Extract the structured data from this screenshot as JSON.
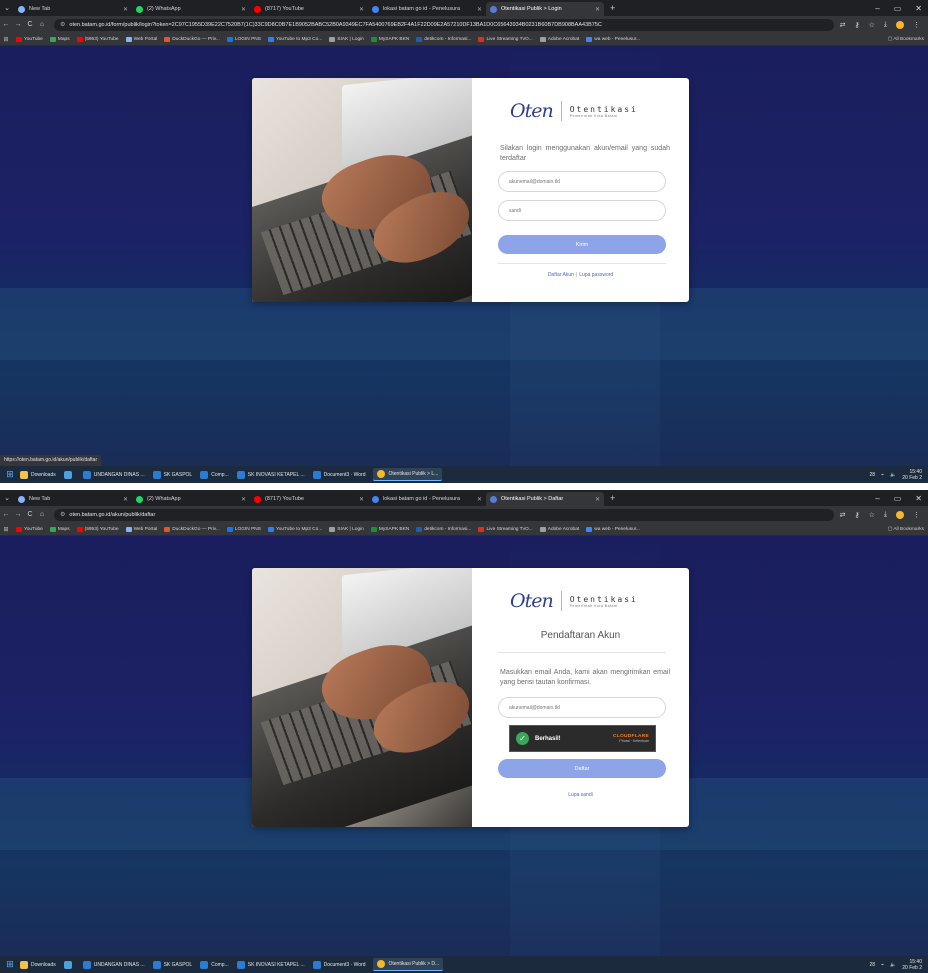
{
  "shots": [
    {
      "tabs": [
        {
          "label": "New Tab",
          "color": "#8ab4f8",
          "active": false
        },
        {
          "label": "(2) WhatsApp",
          "color": "#25d366",
          "active": false
        },
        {
          "label": "(8717) YouTube",
          "color": "#ff0000",
          "active": false
        },
        {
          "label": "lokasi batam go id - Penelusura",
          "color": "#4285f4",
          "active": false
        },
        {
          "label": "Otentikasi Publik > Login",
          "color": "#5b7bd8",
          "active": true
        }
      ],
      "url": "oten.batam.go.id/form/publik/login?token=2C97C1955D39E22C7520B7(1C)33C9D8C0B7E1B9052BABC52B0A9349EC7FA5400769EB2F4A1F22D09E2A57210DF13BA1D0C65643934B0231B60B7DB908BAA43B75C",
      "form": {
        "description": "Silakan login menggunakan akun/email yang sudah terdaftar",
        "email_placeholder": "akunemail@domain.tld",
        "password_placeholder": "sandi",
        "submit_label": "Kirim",
        "link_register": "Daftar Akun",
        "link_forgot": "Lupa password"
      },
      "status_url": "https://oten.batam.go.id/akun/publik/daftar"
    },
    {
      "tabs": [
        {
          "label": "New Tab",
          "color": "#8ab4f8",
          "active": false
        },
        {
          "label": "(2) WhatsApp",
          "color": "#25d366",
          "active": false
        },
        {
          "label": "(8717) YouTube",
          "color": "#ff0000",
          "active": false
        },
        {
          "label": "lokasi batam go id - Penelusura",
          "color": "#4285f4",
          "active": false
        },
        {
          "label": "Otentikasi Publik > Daftar",
          "color": "#5b7bd8",
          "active": true
        }
      ],
      "url": "oten.batam.go.id/akun/publik/daftar",
      "form": {
        "title": "Pendaftaran Akun",
        "description": "Masukkan email Anda, kami akan mengirimkan email yang berisi tautan konfirmasi.",
        "email_placeholder": "akunemail@domain.tld",
        "captcha_text": "Berhasil!",
        "captcha_brand": "CLOUDFLARE",
        "captcha_links": "Privasi · Ketentuan",
        "submit_label": "Daftar",
        "link_forgot": "Lupa sandi"
      }
    }
  ],
  "bookmarks": [
    {
      "label": "YouTube",
      "color": "#ff0000"
    },
    {
      "label": "Maps",
      "color": "#34a853"
    },
    {
      "label": "(5953) YouTube",
      "color": "#ff0000"
    },
    {
      "label": "Web Portal",
      "color": "#8ab4f8"
    },
    {
      "label": "DuckDuckGo — Priv...",
      "color": "#de5833"
    },
    {
      "label": "LOGIN PNS",
      "color": "#1a73e8"
    },
    {
      "label": "YouTube to Mp3 Co...",
      "color": "#2f80ed"
    },
    {
      "label": "SIAK | Login",
      "color": "#9aa0a6"
    },
    {
      "label": "MySAPK BKN",
      "color": "#1e8e3e"
    },
    {
      "label": "detikcom - Informasi...",
      "color": "#1a5fb4"
    },
    {
      "label": "Live Streaming TvO...",
      "color": "#d93025"
    },
    {
      "label": "Adobe Acrobat",
      "color": "#9aa0a6"
    },
    {
      "label": "wa web - Penelusur...",
      "color": "#4285f4"
    }
  ],
  "bookmarks_all": "All Bookmarks",
  "logo": {
    "script": "Oten",
    "word": "Otentikasi",
    "sub": "Pemerintah Kota Batam"
  },
  "taskbar": {
    "items": [
      {
        "label": "Downloads",
        "color": "#f2c14e",
        "active": false
      },
      {
        "label": "",
        "color": "#4aa3df",
        "active": false
      },
      {
        "label": "UNDANGAN DINAS ...",
        "color": "#2b7cd3",
        "active": false
      },
      {
        "label": "SK GASPOL",
        "color": "#2b7cd3",
        "active": false
      },
      {
        "label": "Comp...",
        "color": "#2b7cd3",
        "active": false
      },
      {
        "label": "SK INOVASI KETAPEL ...",
        "color": "#2b7cd3",
        "active": false
      },
      {
        "label": "Document3 · Word",
        "color": "#2b7cd3",
        "active": false
      }
    ],
    "tray_temp": "28",
    "time": "15:40",
    "date": "20 Feb 2"
  },
  "taskbar_active": [
    "Otentikasi Publik > L...",
    "Otentikasi Publik > D..."
  ]
}
